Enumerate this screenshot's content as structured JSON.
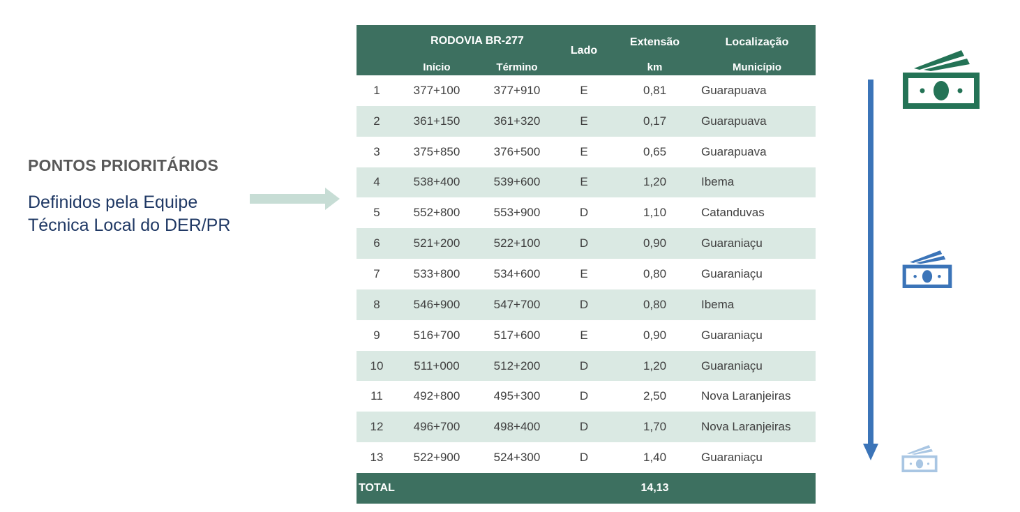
{
  "left": {
    "heading": "PONTOS PRIORITÁRIOS",
    "sub_line1": "Definidos pela Equipe",
    "sub_line2": "Técnica Local do DER/PR"
  },
  "table": {
    "headers": {
      "rodovia": "RODOVIA BR-277",
      "inicio": "Início",
      "termino": "Término",
      "lado": "Lado",
      "extensao": "Extensão",
      "extensao_unit": "km",
      "localizacao": "Localização",
      "municipio": "Município"
    },
    "rows": [
      {
        "n": "1",
        "inicio": "377+100",
        "termino": "377+910",
        "lado": "E",
        "ext": "0,81",
        "municipio": "Guarapuava"
      },
      {
        "n": "2",
        "inicio": "361+150",
        "termino": "361+320",
        "lado": "E",
        "ext": "0,17",
        "municipio": "Guarapuava"
      },
      {
        "n": "3",
        "inicio": "375+850",
        "termino": "376+500",
        "lado": "E",
        "ext": "0,65",
        "municipio": "Guarapuava"
      },
      {
        "n": "4",
        "inicio": "538+400",
        "termino": "539+600",
        "lado": "E",
        "ext": "1,20",
        "municipio": "Ibema"
      },
      {
        "n": "5",
        "inicio": "552+800",
        "termino": "553+900",
        "lado": "D",
        "ext": "1,10",
        "municipio": "Catanduvas"
      },
      {
        "n": "6",
        "inicio": "521+200",
        "termino": "522+100",
        "lado": "D",
        "ext": "0,90",
        "municipio": "Guaraniaçu"
      },
      {
        "n": "7",
        "inicio": "533+800",
        "termino": "534+600",
        "lado": "E",
        "ext": "0,80",
        "municipio": "Guaraniaçu"
      },
      {
        "n": "8",
        "inicio": "546+900",
        "termino": "547+700",
        "lado": "D",
        "ext": "0,80",
        "municipio": "Ibema"
      },
      {
        "n": "9",
        "inicio": "516+700",
        "termino": "517+600",
        "lado": "E",
        "ext": "0,90",
        "municipio": "Guaraniaçu"
      },
      {
        "n": "10",
        "inicio": "511+000",
        "termino": "512+200",
        "lado": "D",
        "ext": "1,20",
        "municipio": "Guaraniaçu"
      },
      {
        "n": "11",
        "inicio": "492+800",
        "termino": "495+300",
        "lado": "D",
        "ext": "2,50",
        "municipio": "Nova Laranjeiras"
      },
      {
        "n": "12",
        "inicio": "496+700",
        "termino": "498+400",
        "lado": "D",
        "ext": "1,70",
        "municipio": "Nova Laranjeiras"
      },
      {
        "n": "13",
        "inicio": "522+900",
        "termino": "524+300",
        "lado": "D",
        "ext": "1,40",
        "municipio": "Guaraniaçu"
      }
    ],
    "total_label": "TOTAL",
    "total_value": "14,13"
  },
  "icons": {
    "pointer_arrow": "arrow-right-icon",
    "priority_arrow": "arrow-down-icon",
    "money_high": "money-bill-icon",
    "money_mid": "money-bill-icon",
    "money_low": "money-bill-icon"
  },
  "colors": {
    "header_green": "#3d7060",
    "row_alt": "#dae9e3",
    "pointer_arrow": "#c7ddd5",
    "down_arrow": "#3b74b8",
    "money_high": "#247356",
    "money_mid": "#3b74b8",
    "money_low": "#a9c6e3"
  }
}
